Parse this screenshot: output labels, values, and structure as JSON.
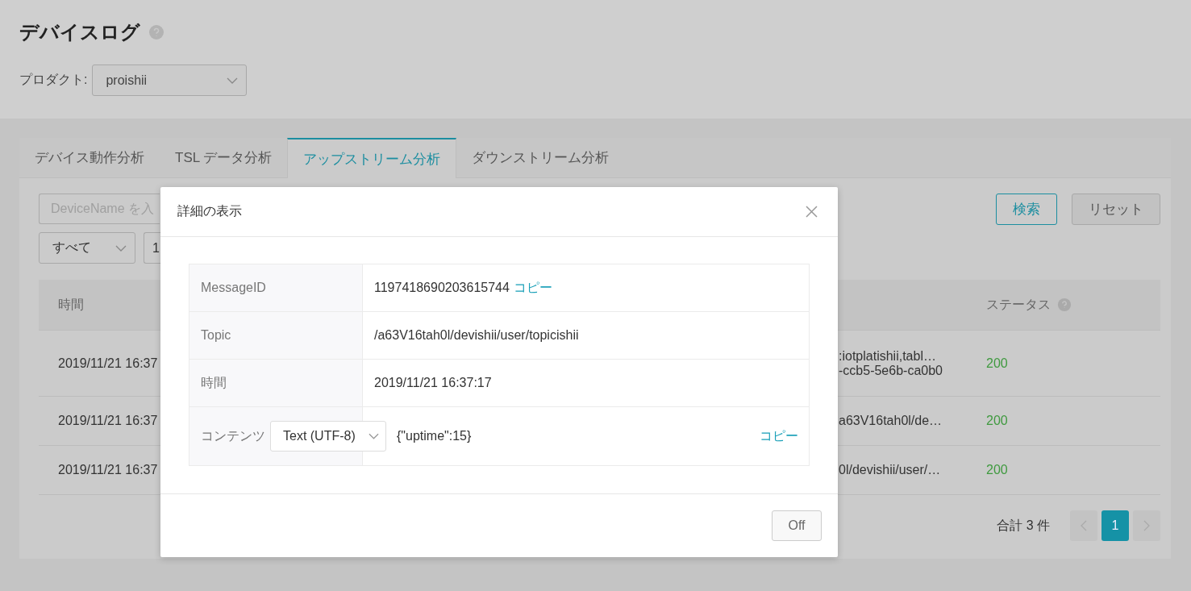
{
  "page": {
    "title": "デバイスログ"
  },
  "product": {
    "label": "プロダクト:",
    "value": "proishii"
  },
  "tabs": [
    {
      "label": "デバイス動作分析",
      "selected": false
    },
    {
      "label": "TSL データ分析",
      "selected": false
    },
    {
      "label": "アップストリーム分析",
      "selected": true
    },
    {
      "label": "ダウンストリーム分析",
      "selected": false
    }
  ],
  "filters": {
    "device_name_placeholder": "DeviceName を入",
    "status_select": "すべて",
    "select_2": "1",
    "search_button": "検索",
    "reset_button": "リセット"
  },
  "table": {
    "columns": [
      "時間",
      "ステータス"
    ],
    "rows": [
      {
        "time": "2019/11/21 16:37",
        "column_2": [
          ":iotplatishii,tabl…",
          "-ccb5-5e6b-ca0b0"
        ],
        "status": "200"
      },
      {
        "time": "2019/11/21 16:37",
        "column_2": [
          "a63V16tah0l/de…"
        ],
        "status": "200"
      },
      {
        "time": "2019/11/21 16:37",
        "column_2": [
          "0l/devishii/user/…"
        ],
        "status": "200"
      }
    ]
  },
  "pagination": {
    "total": "合計 3 件",
    "pages": [
      {
        "label": "1",
        "selected": true
      }
    ]
  },
  "dialog": {
    "title": "詳細の表示",
    "fields": [
      {
        "kind": "copyable",
        "label": "MessageID",
        "value": "1197418690203615744",
        "copy": "コピー"
      },
      {
        "kind": "text",
        "label": "Topic",
        "value": "/a63V16tah0l/devishii/user/topicishii"
      },
      {
        "kind": "text",
        "label": "時間",
        "value": "2019/11/21 16:37:17"
      },
      {
        "kind": "content",
        "label": "コンテンツ",
        "format": "Text (UTF-8)",
        "value": "{\"uptime\":15}",
        "copy": "コピー"
      }
    ],
    "close_button": "Off"
  }
}
